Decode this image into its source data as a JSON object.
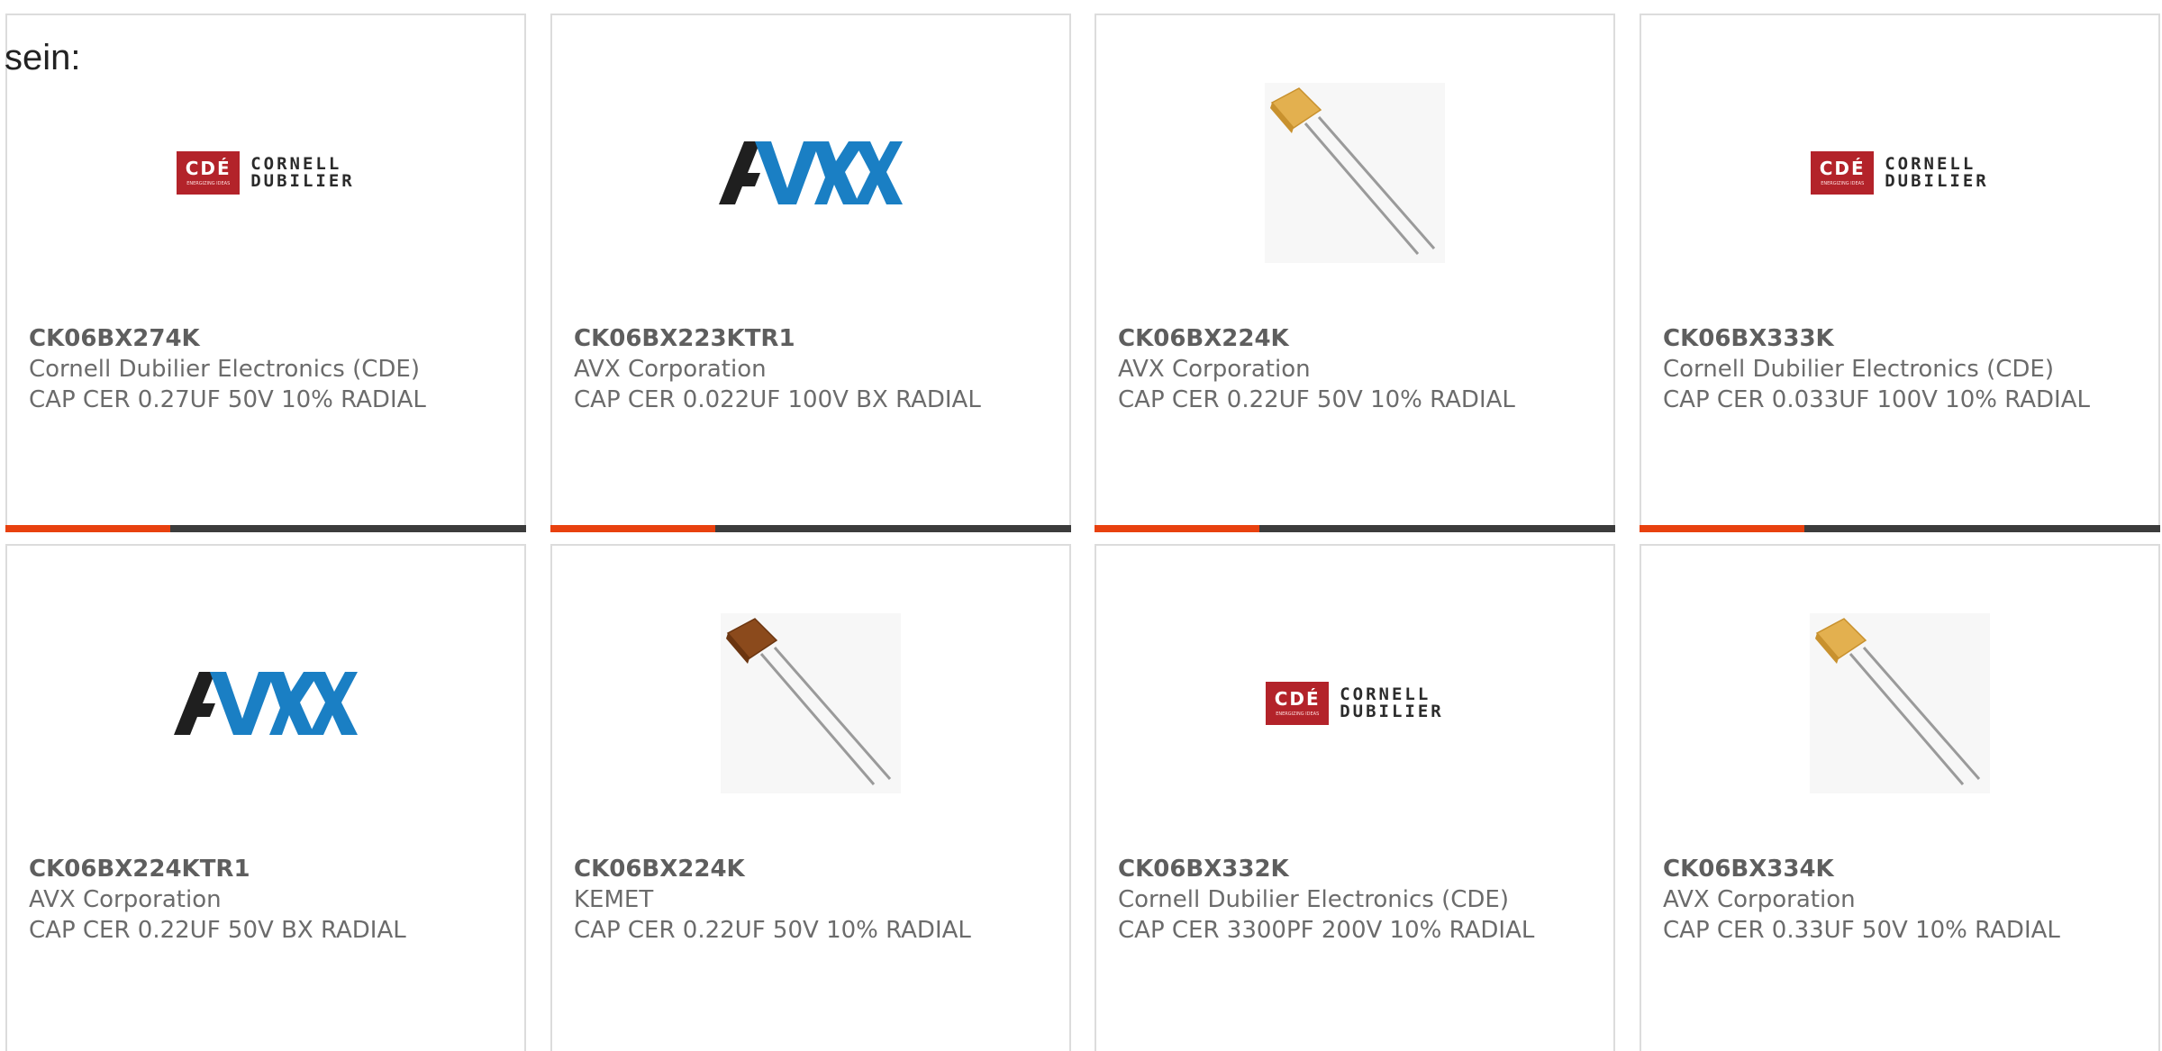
{
  "intro_text": "sein:",
  "accent_color": "#e8410f",
  "bar_color": "#3c3c3c",
  "products": [
    {
      "part": "CK06BX274K",
      "manufacturer": "Cornell Dubilier Electronics (CDE)",
      "description": "CAP CER 0.27UF 50V 10% RADIAL",
      "image": "cde-logo",
      "show_bar": true
    },
    {
      "part": "CK06BX223KTR1",
      "manufacturer": "AVX Corporation",
      "description": "CAP CER 0.022UF 100V BX RADIAL",
      "image": "avx-logo",
      "show_bar": true
    },
    {
      "part": "CK06BX224K",
      "manufacturer": "AVX Corporation",
      "description": "CAP CER 0.22UF 50V 10% RADIAL",
      "image": "capacitor-yellow",
      "show_bar": true
    },
    {
      "part": "CK06BX333K",
      "manufacturer": "Cornell Dubilier Electronics (CDE)",
      "description": "CAP CER 0.033UF 100V 10% RADIAL",
      "image": "cde-logo",
      "show_bar": true
    },
    {
      "part": "CK06BX224KTR1",
      "manufacturer": "AVX Corporation",
      "description": "CAP CER 0.22UF 50V BX RADIAL",
      "image": "avx-logo",
      "show_bar": false
    },
    {
      "part": "CK06BX224K",
      "manufacturer": "KEMET",
      "description": "CAP CER 0.22UF 50V 10% RADIAL",
      "image": "capacitor-brown",
      "show_bar": false
    },
    {
      "part": "CK06BX332K",
      "manufacturer": "Cornell Dubilier Electronics (CDE)",
      "description": "CAP CER 3300PF 200V 10% RADIAL",
      "image": "cde-logo",
      "show_bar": false
    },
    {
      "part": "CK06BX334K",
      "manufacturer": "AVX Corporation",
      "description": "CAP CER 0.33UF 50V 10% RADIAL",
      "image": "capacitor-yellow",
      "show_bar": false
    }
  ],
  "logos": {
    "cde_box_text": "CDÉ",
    "cde_small_text": "ENERGIZING IDEAS",
    "cde_line1": "CORNELL",
    "cde_line2": "DUBILIER",
    "avx_text": "AVX"
  }
}
